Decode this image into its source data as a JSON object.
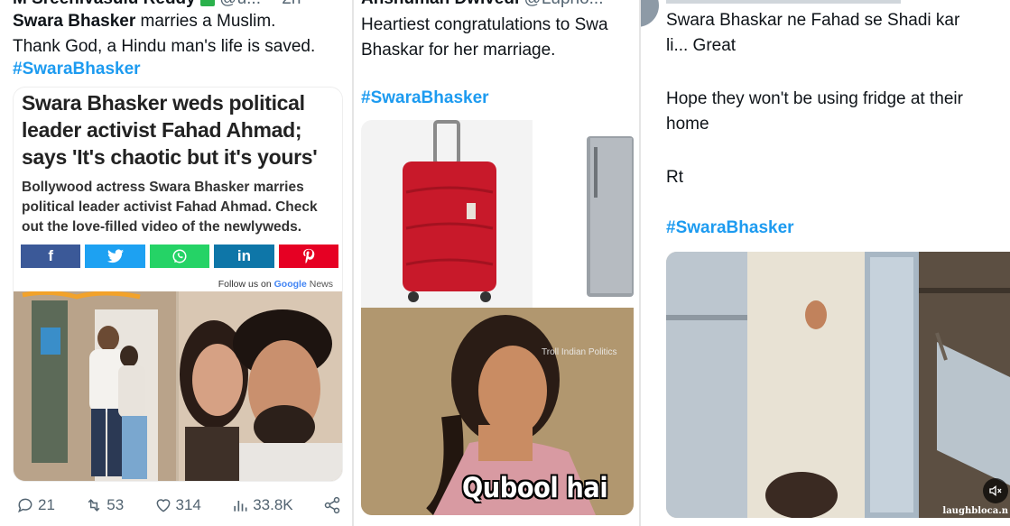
{
  "panel1": {
    "author": "M Sreenivasulu Reddy",
    "handle": "@u...",
    "time": "2h",
    "text_bold": "Swara Bhasker",
    "text_line1_rest": " marries a Muslim.",
    "text_line2": "Thank God, a Hindu man's life is saved.",
    "hashtag": "#SwaraBhasker",
    "article": {
      "headline": "Swara Bhasker weds political leader activist Fahad Ahmad; says 'It's chaotic but it's yours'",
      "summary": "Bollywood actress Swara Bhasker marries political leader activist Fahad Ahmad. Check out the love-filled video of the newlyweds.",
      "share_buttons": [
        {
          "label": "f",
          "color": "#3b5998"
        },
        {
          "label": "🐦",
          "color": "#1da1f2"
        },
        {
          "label": "✆",
          "color": "#25d366"
        },
        {
          "label": "in",
          "color": "#0e76a8"
        },
        {
          "label": "P",
          "color": "#e60023"
        }
      ],
      "follow_text": "Follow us on",
      "follow_google": "Google",
      "follow_news": "News"
    },
    "actions": {
      "replies": "21",
      "retweets": "53",
      "likes": "314",
      "views": "33.8K"
    }
  },
  "panel2": {
    "author": "Anshuman Dwivedi",
    "handle": "@Lupho...",
    "text_line1": "Heartiest congratulations to Swa",
    "text_line2": "Bhaskar for her marriage.",
    "hashtag": "#SwaraBhasker",
    "watermark": "Troll Indian Politics",
    "caption": "Qubool hai"
  },
  "panel3": {
    "text_line1": "Swara Bhaskar ne Fahad se Shadi kar",
    "text_line2": "li... Great",
    "text_line3": "Hope they won't be using fridge at their",
    "text_line4": "home",
    "text_line5": "Rt",
    "hashtag": "#SwaraBhasker",
    "gif_watermark": "laughbloca.n"
  },
  "colors": {
    "hashtag": "#1d9bf0",
    "text": "#0f1419",
    "muted": "#536471"
  }
}
